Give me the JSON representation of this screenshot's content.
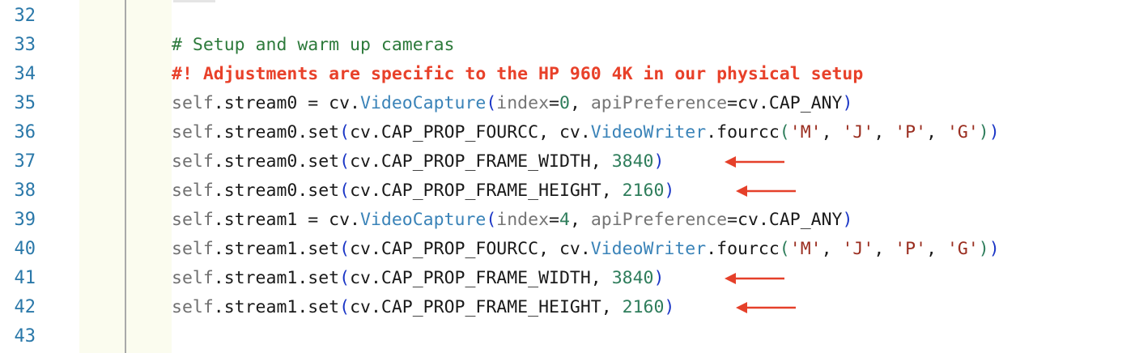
{
  "editor": {
    "colors": {
      "comment": "#2d7a3b",
      "alert_comment": "#e8412a",
      "line_number": "#2a78a9",
      "number_literal": "#2e7d5b",
      "string_literal": "#9a2d1f",
      "class_name": "#3a83b8",
      "paren": "#1b36c6",
      "arrow": "#e5402a"
    },
    "lines": [
      {
        "n": "32"
      },
      {
        "n": "33",
        "t": [
          "# Setup and warm up cameras"
        ]
      },
      {
        "n": "34",
        "t": [
          "#! Adjustments are specific to the HP 960 4K in our physical setup"
        ]
      },
      {
        "n": "35",
        "t": [
          "self",
          ".stream0 = cv.",
          "VideoCapture",
          "(",
          "index",
          "=",
          "0",
          ", ",
          "apiPreference",
          "=cv.CAP_ANY",
          ")"
        ]
      },
      {
        "n": "36",
        "t": [
          "self",
          ".stream0.set",
          "(",
          "cv.CAP_PROP_FOURCC, cv.",
          "VideoWriter",
          ".fourcc",
          "(",
          "'M'",
          ", ",
          "'J'",
          ", ",
          "'P'",
          ", ",
          "'G'",
          ")",
          ")"
        ]
      },
      {
        "n": "37",
        "t": [
          "self",
          ".stream0.set",
          "(",
          "cv.CAP_PROP_FRAME_WIDTH, ",
          "3840",
          ")"
        ]
      },
      {
        "n": "38",
        "t": [
          "self",
          ".stream0.set",
          "(",
          "cv.CAP_PROP_FRAME_HEIGHT, ",
          "2160",
          ")"
        ]
      },
      {
        "n": "39",
        "t": [
          "self",
          ".stream1 = cv.",
          "VideoCapture",
          "(",
          "index",
          "=",
          "4",
          ", ",
          "apiPreference",
          "=cv.CAP_ANY",
          ")"
        ]
      },
      {
        "n": "40",
        "t": [
          "self",
          ".stream1.set",
          "(",
          "cv.CAP_PROP_FOURCC, cv.",
          "VideoWriter",
          ".fourcc",
          "(",
          "'M'",
          ", ",
          "'J'",
          ", ",
          "'P'",
          ", ",
          "'G'",
          ")",
          ")"
        ]
      },
      {
        "n": "41",
        "t": [
          "self",
          ".stream1.set",
          "(",
          "cv.CAP_PROP_FRAME_WIDTH, ",
          "3840",
          ")"
        ]
      },
      {
        "n": "42",
        "t": [
          "self",
          ".stream1.set",
          "(",
          "cv.CAP_PROP_FRAME_HEIGHT, ",
          "2160",
          ")"
        ]
      },
      {
        "n": "43"
      }
    ],
    "annotations": [
      {
        "line": "37",
        "icon": "left-arrow-icon"
      },
      {
        "line": "38",
        "icon": "left-arrow-icon"
      },
      {
        "line": "41",
        "icon": "left-arrow-icon"
      },
      {
        "line": "42",
        "icon": "left-arrow-icon"
      }
    ]
  }
}
